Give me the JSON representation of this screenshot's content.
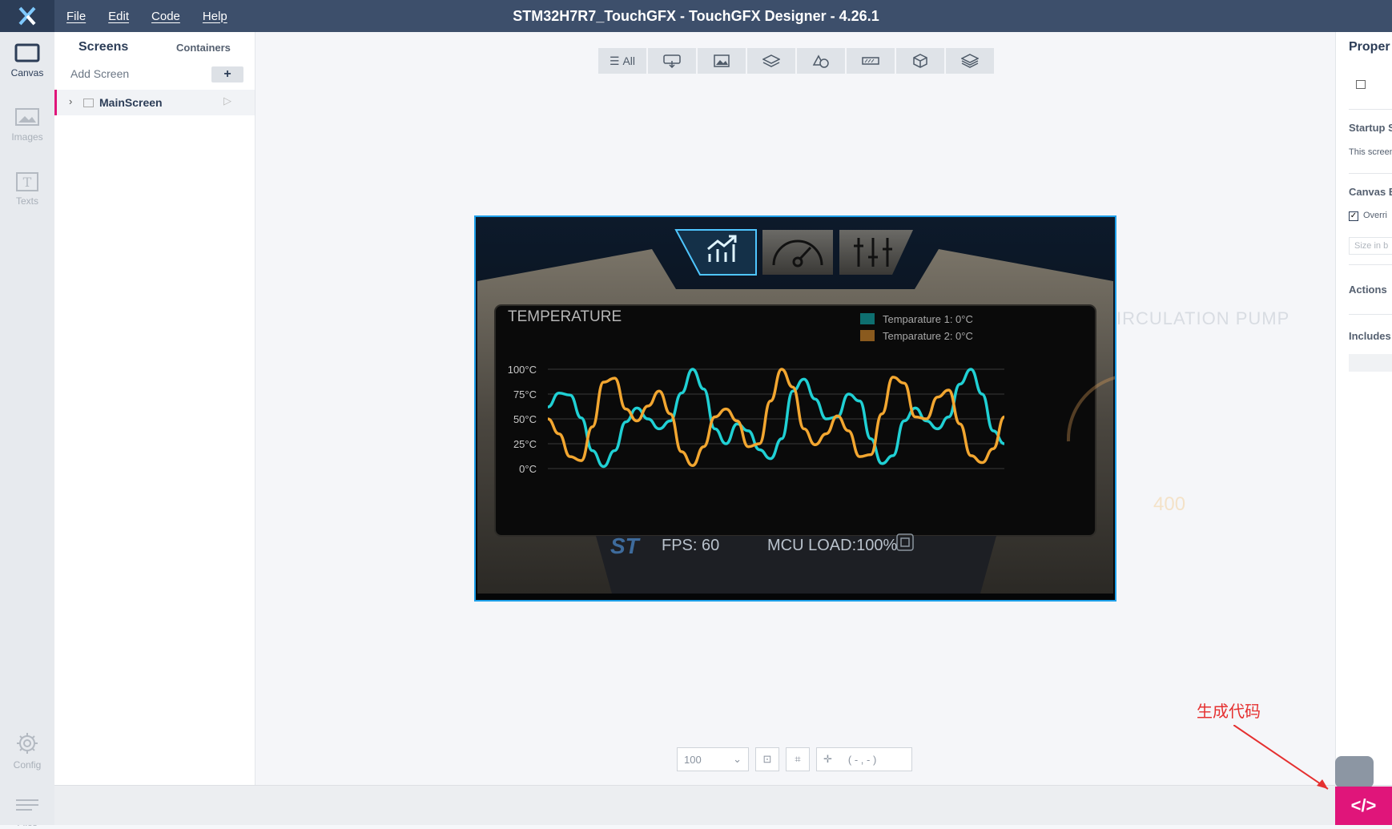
{
  "window": {
    "title": "STM32H7R7_TouchGFX - TouchGFX Designer - 4.26.1"
  },
  "menu": {
    "file": "File",
    "edit": "Edit",
    "code": "Code",
    "help": "Help"
  },
  "leftbar": {
    "canvas": "Canvas",
    "images": "Images",
    "texts": "Texts",
    "config": "Config",
    "files": "Files"
  },
  "screens": {
    "title": "Screens",
    "containers": "Containers",
    "add": "Add Screen",
    "plus": "+",
    "items": [
      {
        "label": "MainScreen"
      }
    ]
  },
  "toolbar": {
    "all": "All",
    "icons": [
      "interaction-icon",
      "image-icon",
      "layers-icon",
      "shapes-icon",
      "progress-icon",
      "3d-icon",
      "stack-icon"
    ]
  },
  "bottom": {
    "zoom": "100",
    "coords": "( - , - )"
  },
  "properties": {
    "title": "Proper",
    "startup": "Startup S",
    "startup_desc": "This screen",
    "canvas": "Canvas B",
    "override": "Overri",
    "size": "Size in b",
    "actions": "Actions",
    "includes": "Includes"
  },
  "device": {
    "tab_icons": [
      "chart-icon",
      "gauge-icon",
      "sliders-icon"
    ],
    "panel_title": "TEMPERATURE",
    "legend": [
      {
        "label": "Temparature 1: 0°C",
        "color": "#0e6f70"
      },
      {
        "label": "Temparature 2: 0°C",
        "color": "#8a5a1e"
      }
    ],
    "fps": "FPS: 60",
    "mcu": "MCU LOAD:100%",
    "ghost_title": "IRCULATION PUMP",
    "ghost_value": "400"
  },
  "chart_data": {
    "type": "line",
    "title": "TEMPERATURE",
    "y_ticks": [
      "100°C",
      "75°C",
      "50°C",
      "25°C",
      "0°C"
    ],
    "ylim": [
      0,
      100
    ],
    "grid": true,
    "series": [
      {
        "name": "Temparature 1: 0°C",
        "color": "#20d0d4",
        "values": [
          62,
          76,
          74,
          51,
          18,
          2,
          18,
          47,
          61,
          50,
          40,
          48,
          76,
          100,
          80,
          40,
          25,
          45,
          38,
          19,
          10,
          30,
          78,
          90,
          70,
          50,
          52,
          75,
          68,
          30,
          5,
          13,
          48,
          61,
          48,
          40,
          52,
          85,
          100,
          75,
          38,
          25
        ]
      },
      {
        "name": "Temparature 2: 0°C",
        "color": "#f2a630",
        "values": [
          50,
          35,
          12,
          8,
          42,
          87,
          91,
          60,
          48,
          63,
          78,
          55,
          17,
          3,
          22,
          52,
          60,
          48,
          22,
          25,
          68,
          100,
          82,
          40,
          24,
          35,
          53,
          38,
          12,
          14,
          55,
          92,
          86,
          52,
          50,
          72,
          79,
          45,
          13,
          6,
          20,
          52
        ]
      }
    ]
  },
  "annotation": {
    "text": "生成代码"
  },
  "generate_button": {
    "label": "</>"
  }
}
